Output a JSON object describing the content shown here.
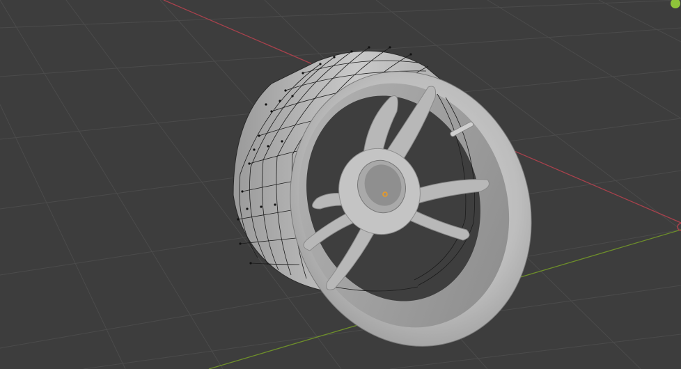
{
  "app": {
    "title": ""
  },
  "viewport": {
    "background": "#3d3d3d",
    "grid_color": "#4b4b4b",
    "x_axis_color": "#a8414c",
    "y_axis_color": "#6e8f2a",
    "gizmo_dot_color": "#8ec43a",
    "origin_color": "#f09b1c"
  },
  "object": {
    "name": "",
    "mode": "edit",
    "icon": "wheel-mesh"
  }
}
